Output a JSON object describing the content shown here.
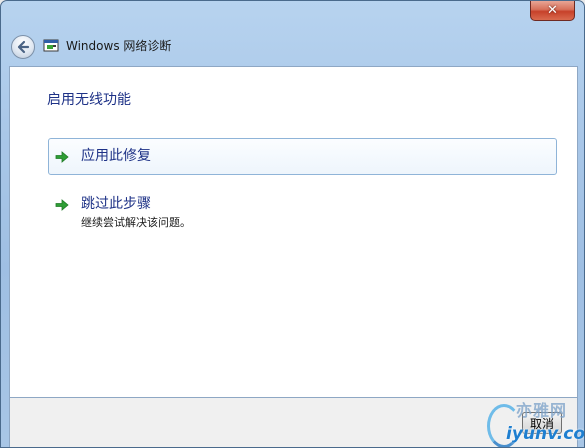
{
  "window": {
    "title": "Windows 网络诊断",
    "close_label": "✕"
  },
  "main": {
    "heading": "启用无线功能",
    "options": [
      {
        "label": "应用此修复",
        "description": "",
        "icon": "green-arrow-icon"
      },
      {
        "label": "跳过此步骤",
        "description": "继续尝试解决该问题。",
        "icon": "green-arrow-icon"
      }
    ]
  },
  "footer": {
    "cancel_label": "取消"
  },
  "watermark": {
    "text": "亦雅网",
    "url": "iyunv.com"
  }
}
